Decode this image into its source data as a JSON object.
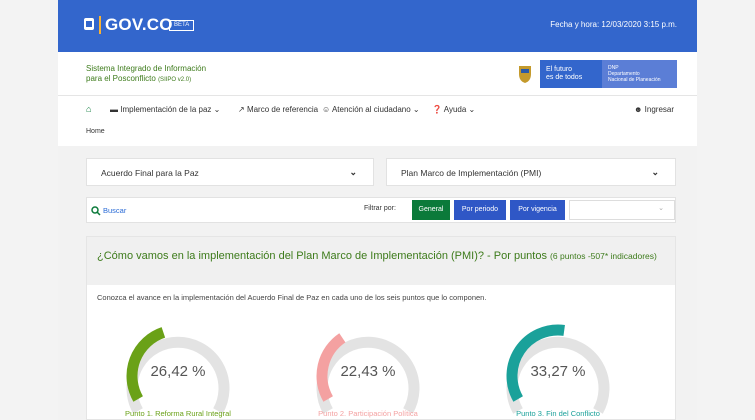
{
  "header": {
    "logo_text": "GOV.CO",
    "beta_label": "BETA",
    "datetime": "Fecha y hora: 12/03/2020 3:15 p.m."
  },
  "system": {
    "title_line1": "Sistema Integrado de Información",
    "title_line2": "para el Posconflicto",
    "version": "(SIIPO v2.0)",
    "future_line1": "El futuro",
    "future_line2": "es de todos",
    "dnp_line1": "DNP",
    "dnp_line2": "Departamento",
    "dnp_line3": "Nacional de Planeación"
  },
  "nav": {
    "items": [
      {
        "label": "Implementación de la paz",
        "icon": "book-icon",
        "dropdown": true
      },
      {
        "label": "Marco de referencia",
        "icon": "link-icon",
        "dropdown": false
      },
      {
        "label": "Atención al ciudadano",
        "icon": "people-icon",
        "dropdown": true
      },
      {
        "label": "Ayuda",
        "icon": "question-icon",
        "dropdown": true
      }
    ],
    "login_label": "Ingresar"
  },
  "breadcrumb": "Home",
  "dropdowns": {
    "left_label": "Acuerdo Final para la Paz",
    "right_label": "Plan Marco de Implementación (PMI)"
  },
  "filters": {
    "search_label": "Buscar",
    "filter_label": "Filtrar por:",
    "buttons": [
      "General",
      "Por periodo",
      "Por vigencia"
    ],
    "active": "General"
  },
  "card": {
    "title": "¿Cómo vamos en la implementación del Plan Marco de Implementación (PMI)? - Por puntos",
    "subtitle": "(6 puntos -507* indicadores)",
    "description": "Conozca el avance en la implementación del Acuerdo Final de Paz en cada uno de los seis puntos que lo componen."
  },
  "gauges": [
    {
      "value_label": "26,42 %",
      "value": 26.42,
      "caption": "Punto 1. Reforma Rural Integral",
      "color": "#6aa117"
    },
    {
      "value_label": "22,43 %",
      "value": 22.43,
      "caption": "Punto 2. Participación Política",
      "color": "#f4a1a1"
    },
    {
      "value_label": "33,27 %",
      "value": 33.27,
      "caption": "Punto 3. Fin del Conflicto",
      "color": "#1aa19a"
    }
  ],
  "colors": {
    "primary_blue": "#3366cc",
    "green": "#3d7b1b",
    "button_green": "#0b7a3a",
    "button_blue": "#2f57c6"
  }
}
